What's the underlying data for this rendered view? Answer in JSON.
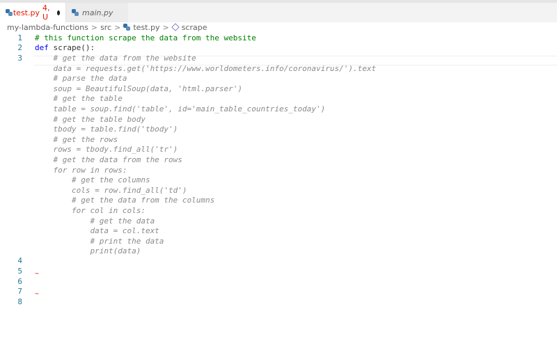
{
  "tabs": [
    {
      "name": "test.py",
      "badge": "4, U",
      "modified": true
    },
    {
      "name": "main.py"
    }
  ],
  "breadcrumb": [
    "my-lambda-functions",
    "src",
    "test.py",
    "scrape"
  ],
  "code": {
    "line1": "# this function scrape the data from the website",
    "line2_kw": "def",
    "line2_rest": " scrape():",
    "ghost": [
      "    # get the data from the website",
      "    data = requests.get('https://www.worldometers.info/coronavirus/').text",
      "    # parse the data",
      "    soup = BeautifulSoup(data, 'html.parser')",
      "    # get the table",
      "    table = soup.find('table', id='main_table_countries_today')",
      "    # get the table body",
      "    tbody = table.find('tbody')",
      "    # get the rows",
      "    rows = tbody.find_all('tr')",
      "    # get the data from the rows",
      "    for row in rows:",
      "        # get the columns",
      "        cols = row.find_all('td')",
      "        # get the data from the columns",
      "        for col in cols:",
      "            # get the data",
      "            data = col.text",
      "            # print the data",
      "            print(data)"
    ],
    "line_numbers": [
      "1",
      "2",
      "3",
      "4",
      "5",
      "6",
      "7",
      "8"
    ]
  },
  "colors": {
    "comment": "#008000",
    "keyword": "#0000ff",
    "error": "#e51400",
    "line_number": "#237893"
  }
}
